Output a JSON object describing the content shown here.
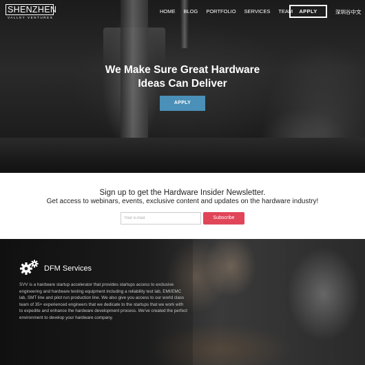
{
  "header": {
    "logo_main": "SHENZHEN",
    "logo_sub": "VALLEY VENTURES",
    "nav": [
      "HOME",
      "BLOG",
      "PORTFOLIO",
      "SERVICES",
      "TEAM"
    ],
    "apply_label": "APPLY",
    "lang_label": "深圳谷中文"
  },
  "hero": {
    "title_line1": "We Make Sure Great Hardware",
    "title_line2": "Ideas Can Deliver",
    "apply_label": "APPLY"
  },
  "newsletter": {
    "title": "Sign up to get the Hardware Insider Newsletter.",
    "subtitle": "Get access to webinars, events, exclusive content and updates on the hardware industry!",
    "email_placeholder": "Your e-mail",
    "subscribe_label": "Subscribe"
  },
  "dfm": {
    "icon": "gears-icon",
    "title": "DFM Services",
    "body": "SVV is a hardware startup accelerator that provides startups access to exclusive engineering and hardware testing equipment including a reliability test lab, EMI/EMC lab, SMT line and pilot run production line. We also give you access to our world class team of 35+ experienced engineers that we dedicate to the startups that we work with to expedite and enhance the hardware development process. We've created the perfect environment to develop your hardware company."
  },
  "colors": {
    "accent_blue": "#4a90b8",
    "subscribe_red": "#e04558"
  }
}
